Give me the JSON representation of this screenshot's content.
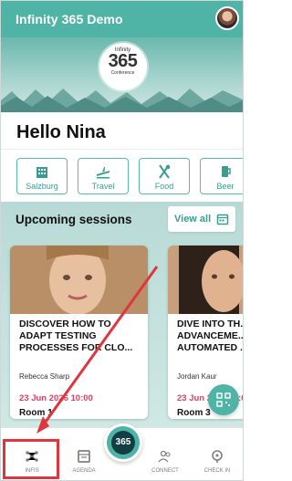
{
  "app": {
    "title": "Infinity 365 Demo",
    "accent_color": "#4fb3a6",
    "date_color": "#e33d67",
    "highlight_color": "#e0353e"
  },
  "hero": {
    "logo_top": "Infinity",
    "logo_number": "365",
    "logo_bottom": "Conference"
  },
  "greeting": "Hello Nina",
  "categories": [
    {
      "label": "Salzburg",
      "icon": "building-icon"
    },
    {
      "label": "Travel",
      "icon": "plane-icon"
    },
    {
      "label": "Food",
      "icon": "fork-knife-icon"
    },
    {
      "label": "Beer",
      "icon": "beer-icon"
    }
  ],
  "sessions": {
    "heading": "Upcoming sessions",
    "view_all": "View all",
    "cards": [
      {
        "title": "DISCOVER HOW TO ADAPT TESTING PROCESSES FOR CLO...",
        "speaker": "Rebecca  Sharp",
        "date": "23 Jun 2026 10:00",
        "room": "Room 1"
      },
      {
        "title": "DIVE INTO TH... ADVANCEME... AUTOMATED ...",
        "speaker": "Jordan  Kaur",
        "date": "23 Jun 2026 10:00",
        "room": "Room 3"
      }
    ]
  },
  "bottom_nav": {
    "items": [
      {
        "label": "INFIS",
        "icon": "nodes-icon"
      },
      {
        "label": "AGENDA",
        "icon": "calendar-icon"
      },
      {
        "label": "CONNECT",
        "icon": "people-icon"
      },
      {
        "label": "CHECK IN",
        "icon": "location-pin-icon"
      }
    ],
    "center_button": "365"
  }
}
